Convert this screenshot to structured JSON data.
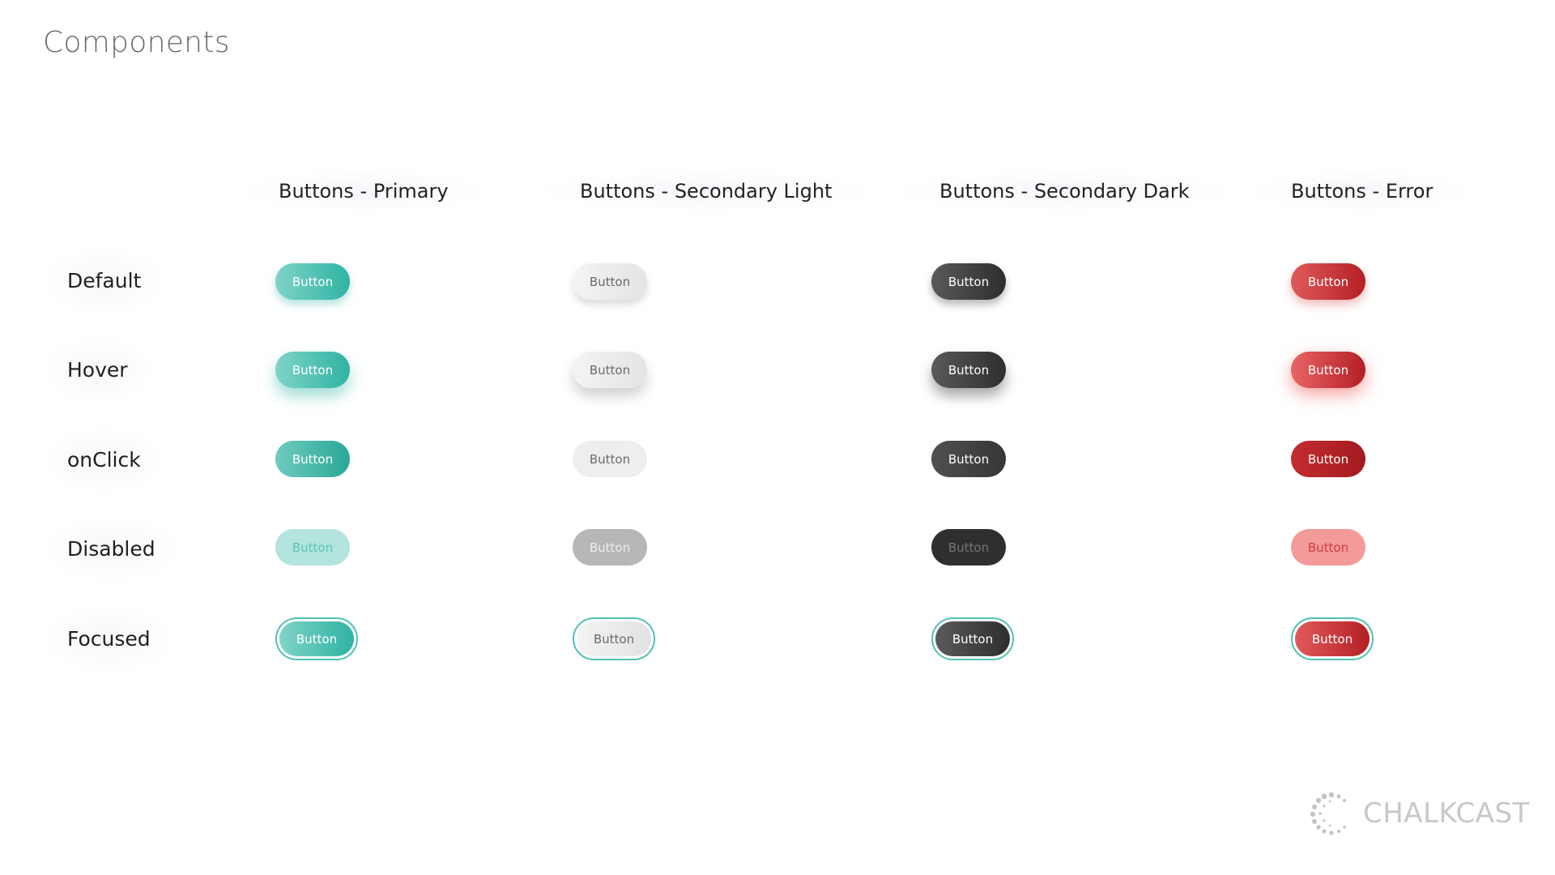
{
  "page": {
    "title": "Components"
  },
  "columns": [
    "Buttons - Primary",
    "Buttons - Secondary Light",
    "Buttons - Secondary Dark",
    "Buttons - Error"
  ],
  "rows": [
    "Default",
    "Hover",
    "onClick",
    "Disabled",
    "Focused"
  ],
  "button_label": "Button",
  "colors": {
    "primary": "#2fb3a3",
    "primary_light": "#7fd3c7",
    "secondary_light": "#e4e4e4",
    "secondary_dark": "#2e2e2e",
    "error": "#b41f24",
    "focus_ring": "#4ec2b4"
  },
  "brand": {
    "name": "CHALKCAST",
    "icon": "chalkcast-dots-logo-icon"
  }
}
